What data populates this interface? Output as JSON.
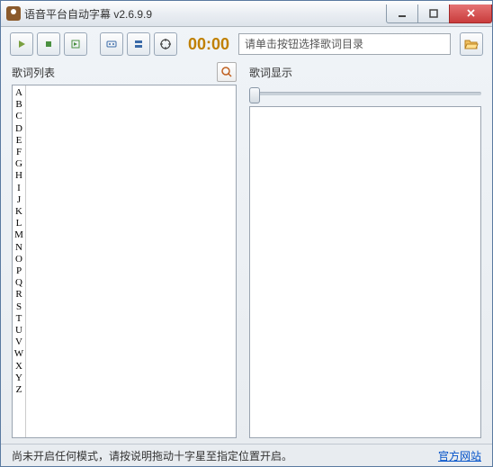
{
  "window": {
    "title": "语音平台自动字幕 v2.6.9.9"
  },
  "toolbar": {
    "time": "00:00",
    "path_placeholder": "请单击按钮选择歌词目录"
  },
  "left_panel": {
    "title": "歌词列表",
    "alphabet": [
      "A",
      "B",
      "C",
      "D",
      "E",
      "F",
      "G",
      "H",
      "I",
      "J",
      "K",
      "L",
      "M",
      "N",
      "O",
      "P",
      "Q",
      "R",
      "S",
      "T",
      "U",
      "V",
      "W",
      "X",
      "Y",
      "Z"
    ]
  },
  "right_panel": {
    "title": "歌词显示"
  },
  "status": {
    "text": "尚未开启任何模式，请按说明拖动十字星至指定位置开启。",
    "link": "官方网站"
  }
}
